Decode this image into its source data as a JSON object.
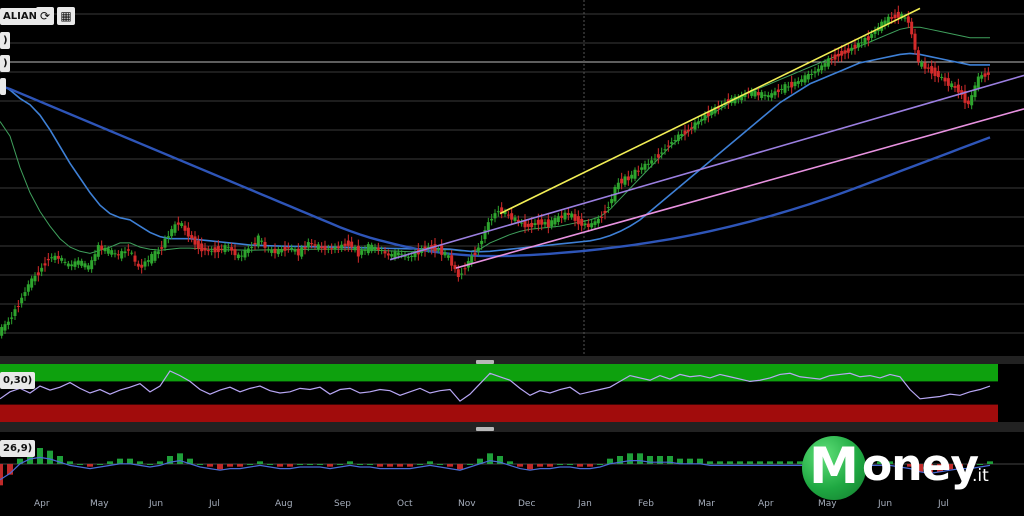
{
  "toolbar": {
    "symbol_label": "ALIANE",
    "refresh_icon": "refresh-icon",
    "calendar_icon": "calendar-icon"
  },
  "price_panel": {
    "indicator_tags": [
      ")",
      ")",
      ""
    ]
  },
  "rsi_panel": {
    "label": "0,30)"
  },
  "macd_panel": {
    "label": "26,9)"
  },
  "x_axis": {
    "months": [
      "Apr",
      "May",
      "Jun",
      "Jul",
      "Aug",
      "Sep",
      "Oct",
      "Nov",
      "Dec",
      "Jan",
      "Feb",
      "Mar",
      "Apr",
      "May",
      "Jun",
      "Jul"
    ]
  },
  "logo": {
    "letter": "M",
    "word": "oney",
    "domain": ".it"
  },
  "colors": {
    "up": "#2ea52e",
    "down": "#d42b2b",
    "ma_fast": "#3f9f5c",
    "ma_mid": "#3e80d6",
    "ma_slow": "#2e55b8",
    "trend_yellow": "#f2ee55",
    "trend_purple": "#9b7fe0",
    "trend_pink": "#e892e0",
    "rsi_line": "#b8a7f5",
    "rsi_overbought": "#0ea10e",
    "rsi_oversold": "#a10c0c",
    "macd_hist_pos": "#1f9f3a",
    "macd_hist_neg": "#c02a2a"
  },
  "chart_data": {
    "type": "line",
    "price_series": {
      "name": "",
      "x_index": [
        0,
        10,
        20,
        30,
        40,
        50,
        60,
        70,
        80,
        90,
        100,
        110,
        120,
        130,
        140,
        150,
        160,
        170,
        180,
        190,
        200,
        210,
        220,
        230,
        240,
        250,
        260,
        270,
        280,
        290,
        300,
        310,
        320,
        330,
        340,
        350,
        360,
        370,
        380,
        390,
        400,
        410,
        420,
        430,
        440,
        450,
        460,
        470,
        480,
        490,
        500,
        510,
        520,
        530,
        540,
        550,
        560,
        570,
        580,
        590,
        600,
        610,
        620,
        630,
        640,
        650,
        660,
        670,
        680,
        690,
        700,
        710,
        720,
        730,
        740,
        750,
        760,
        770,
        780,
        790,
        800,
        810,
        820,
        830,
        840,
        850,
        860,
        870,
        880,
        890,
        900,
        910,
        920,
        930,
        940,
        950,
        960,
        970,
        980,
        990
      ],
      "close": [
        110,
        165,
        250,
        340,
        400,
        470,
        470,
        430,
        450,
        420,
        520,
        500,
        480,
        510,
        420,
        460,
        500,
        580,
        640,
        580,
        520,
        500,
        510,
        520,
        470,
        510,
        560,
        500,
        500,
        520,
        490,
        540,
        520,
        510,
        520,
        540,
        490,
        520,
        510,
        480,
        490,
        470,
        500,
        520,
        510,
        470,
        380,
        450,
        520,
        640,
        700,
        670,
        640,
        620,
        640,
        630,
        660,
        680,
        640,
        620,
        650,
        720,
        830,
        850,
        890,
        920,
        960,
        1010,
        1050,
        1080,
        1120,
        1160,
        1190,
        1220,
        1230,
        1260,
        1250,
        1240,
        1270,
        1290,
        1310,
        1340,
        1370,
        1410,
        1440,
        1460,
        1490,
        1520,
        1570,
        1610,
        1630,
        1600,
        1400,
        1370,
        1340,
        1300,
        1270,
        1200,
        1330,
        1350
      ]
    },
    "moving_averages": [
      {
        "name": "",
        "values": [
          1120,
          1050,
          900,
          780,
          690,
          620,
          560,
          520,
          500,
          490,
          505,
          520,
          540,
          540,
          520,
          510,
          505,
          510,
          515,
          515,
          513,
          510,
          508,
          507,
          506,
          505,
          506,
          507,
          508,
          508,
          508,
          510,
          510,
          510,
          510,
          510,
          508,
          506,
          504,
          502,
          500,
          498,
          500,
          503,
          506,
          508,
          502,
          500,
          510,
          540,
          560,
          580,
          595,
          605,
          610,
          615,
          620,
          630,
          640,
          650,
          665,
          700,
          750,
          800,
          850,
          900,
          950,
          1000,
          1040,
          1080,
          1120,
          1150,
          1180,
          1210,
          1235,
          1260,
          1280,
          1300,
          1320,
          1340,
          1360,
          1380,
          1400,
          1420,
          1440,
          1460,
          1480,
          1500,
          1520,
          1540,
          1560,
          1570,
          1570,
          1560,
          1550,
          1540,
          1530,
          1520,
          1520,
          1520
        ]
      },
      {
        "name": "",
        "values": [
          1300,
          1270,
          1230,
          1200,
          1150,
          1080,
          1000,
          920,
          850,
          780,
          720,
          680,
          660,
          650,
          620,
          590,
          570,
          560,
          560,
          560,
          555,
          550,
          545,
          540,
          535,
          530,
          528,
          526,
          525,
          524,
          523,
          522,
          521,
          520,
          519,
          518,
          517,
          516,
          515,
          514,
          513,
          512,
          512,
          512,
          512,
          510,
          505,
          500,
          498,
          500,
          505,
          510,
          515,
          520,
          525,
          530,
          535,
          540,
          545,
          550,
          560,
          575,
          595,
          620,
          650,
          690,
          730,
          770,
          810,
          850,
          890,
          930,
          970,
          1010,
          1050,
          1090,
          1130,
          1170,
          1210,
          1240,
          1270,
          1300,
          1320,
          1340,
          1360,
          1380,
          1400,
          1410,
          1420,
          1430,
          1440,
          1445,
          1440,
          1430,
          1420,
          1410,
          1400,
          1390,
          1390,
          1390
        ]
      },
      {
        "name": "",
        "values": [
          1290,
          1275,
          1255,
          1235,
          1215,
          1195,
          1175,
          1155,
          1135,
          1115,
          1095,
          1075,
          1055,
          1035,
          1015,
          995,
          975,
          955,
          935,
          915,
          895,
          875,
          855,
          835,
          815,
          795,
          775,
          755,
          735,
          715,
          695,
          675,
          655,
          635,
          615,
          597,
          580,
          565,
          552,
          540,
          528,
          518,
          508,
          500,
          494,
          488,
          484,
          480,
          478,
          477,
          477,
          478,
          480,
          482,
          485,
          488,
          492,
          496,
          500,
          505,
          510,
          516,
          522,
          528,
          535,
          542,
          550,
          558,
          567,
          576,
          586,
          596,
          607,
          618,
          630,
          642,
          655,
          668,
          682,
          696,
          711,
          726,
          742,
          758,
          775,
          792,
          810,
          828,
          846,
          864,
          882,
          900,
          918,
          936,
          954,
          972,
          990,
          1008,
          1026,
          1044
        ]
      }
    ],
    "trendlines": [
      {
        "name": "",
        "x": [
          500,
          920
        ],
        "y": [
          680,
          1660
        ]
      },
      {
        "name": "",
        "x": [
          390,
          1024
        ],
        "y": [
          460,
          1340
        ]
      },
      {
        "name": "",
        "x": [
          456,
          1024
        ],
        "y": [
          420,
          1180
        ]
      }
    ],
    "rsi": {
      "values": [
        40,
        52,
        58,
        50,
        62,
        55,
        60,
        68,
        58,
        50,
        56,
        48,
        55,
        60,
        66,
        52,
        62,
        88,
        80,
        70,
        56,
        48,
        55,
        60,
        52,
        58,
        62,
        54,
        50,
        52,
        58,
        56,
        60,
        48,
        56,
        58,
        50,
        52,
        56,
        54,
        46,
        52,
        58,
        50,
        54,
        56,
        36,
        48,
        66,
        84,
        78,
        72,
        58,
        46,
        54,
        50,
        56,
        60,
        48,
        52,
        56,
        60,
        70,
        80,
        76,
        72,
        80,
        74,
        82,
        78,
        80,
        76,
        82,
        78,
        74,
        70,
        72,
        76,
        82,
        84,
        78,
        76,
        74,
        80,
        82,
        84,
        78,
        80,
        76,
        82,
        78,
        56,
        40,
        42,
        44,
        48,
        46,
        52,
        56,
        62
      ],
      "ylim": [
        0,
        100
      ],
      "upper": 70,
      "lower": 30
    },
    "macd": {
      "histogram": [
        -8,
        -4,
        2,
        5,
        6,
        5,
        3,
        1,
        0,
        -1,
        0,
        1,
        2,
        2,
        1,
        0,
        1,
        3,
        4,
        2,
        0,
        -1,
        -2,
        -1,
        -1,
        0,
        1,
        0,
        -1,
        -1,
        0,
        0,
        0,
        -1,
        0,
        1,
        0,
        0,
        -1,
        -1,
        -1,
        -1,
        0,
        1,
        0,
        -1,
        -2,
        0,
        2,
        4,
        3,
        1,
        -1,
        -2,
        -1,
        -1,
        0,
        0,
        -1,
        -1,
        0,
        2,
        3,
        4,
        4,
        3,
        3,
        3,
        2,
        2,
        2,
        1,
        1,
        1,
        1,
        1,
        1,
        1,
        1,
        1,
        1,
        1,
        1,
        1,
        1,
        1,
        1,
        1,
        1,
        1,
        0,
        -1,
        -3,
        -4,
        -3,
        -2,
        -1,
        -1,
        0,
        1
      ],
      "ylim": [
        -12,
        12
      ]
    },
    "xlim": [
      0,
      1024
    ],
    "ylim": [
      0,
      1700
    ],
    "grid": true
  }
}
